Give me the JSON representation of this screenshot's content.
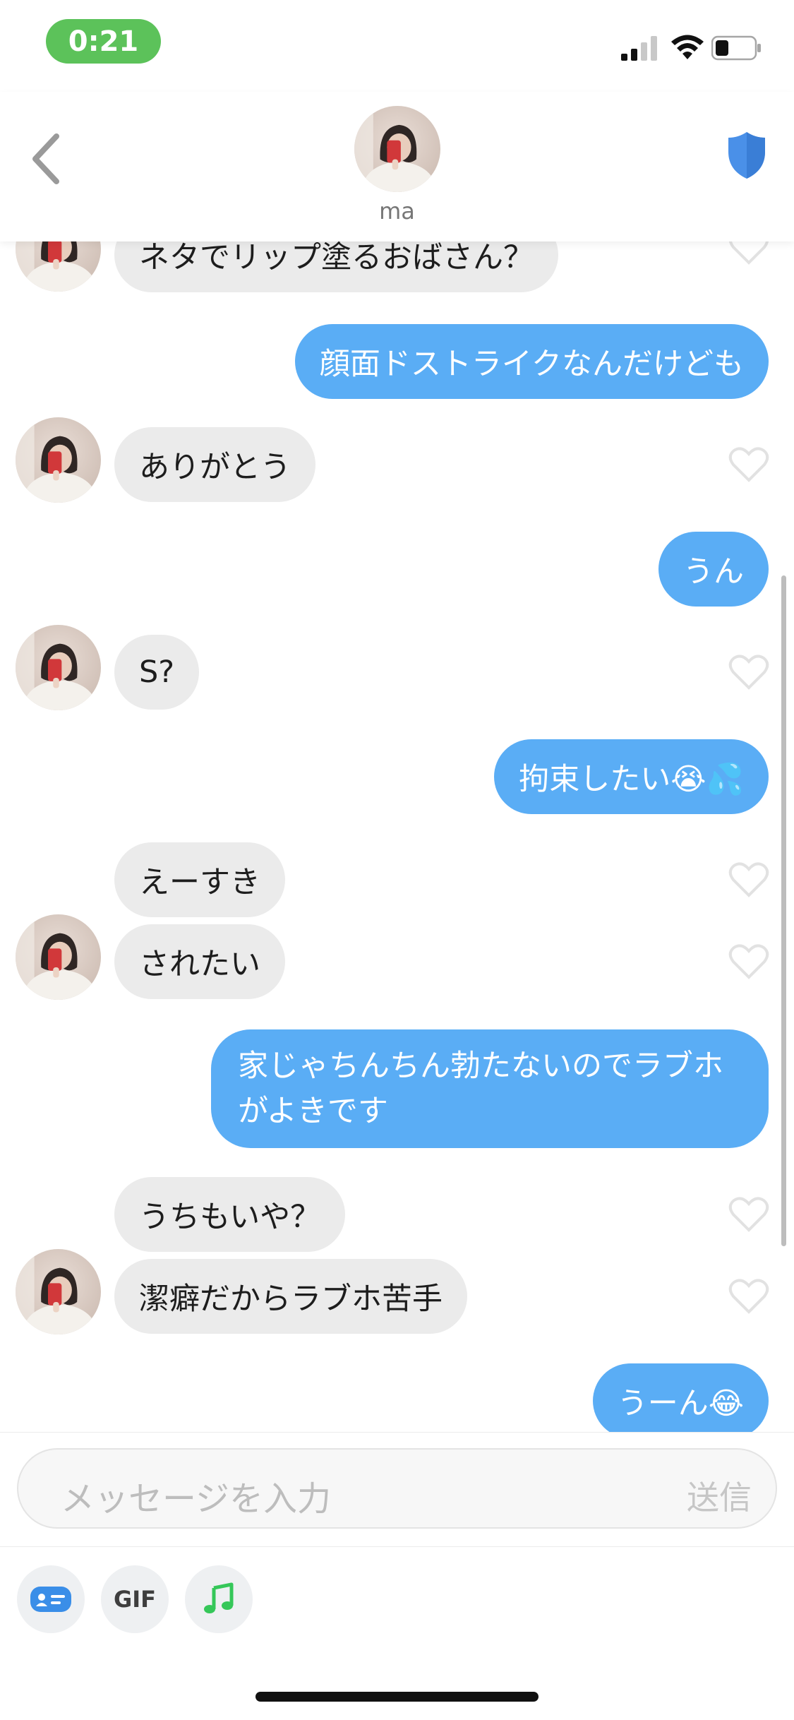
{
  "status_bar": {
    "time": "0:21",
    "battery_level": 0.35
  },
  "header": {
    "contact_name": "ma",
    "back_icon": "chevron-left-icon",
    "safety_icon": "shield-icon"
  },
  "messages": [
    {
      "from": "them",
      "text": "ネタでリップ塗るおばさん？"
    },
    {
      "from": "me",
      "text": "顔面ドストライクなんだけども"
    },
    {
      "from": "them",
      "text": "ありがとう"
    },
    {
      "from": "me",
      "text": "うん"
    },
    {
      "from": "them",
      "text": "S?"
    },
    {
      "from": "me",
      "text": "拘束したい😭💦"
    },
    {
      "from": "them",
      "text": "えーすき"
    },
    {
      "from": "them",
      "text": "されたい"
    },
    {
      "from": "me",
      "text": "家じゃちんちん勃たないのでラブホがよきです"
    },
    {
      "from": "them",
      "text": "うちもいや？"
    },
    {
      "from": "them",
      "text": "潔癖だからラブホ苦手"
    },
    {
      "from": "me",
      "text": "うーん😂"
    }
  ],
  "composer": {
    "placeholder": "メッセージを入力",
    "send_label": "送信"
  },
  "toolbar": {
    "card_icon": "id-card-icon",
    "gif_label": "GIF",
    "music_icon": "music-note-icon"
  },
  "colors": {
    "outgoing_bubble": "#5aadf5",
    "incoming_bubble": "#ebebeb",
    "time_pill": "#5cc25a",
    "shield": "#4a90e8",
    "music": "#35c759"
  }
}
